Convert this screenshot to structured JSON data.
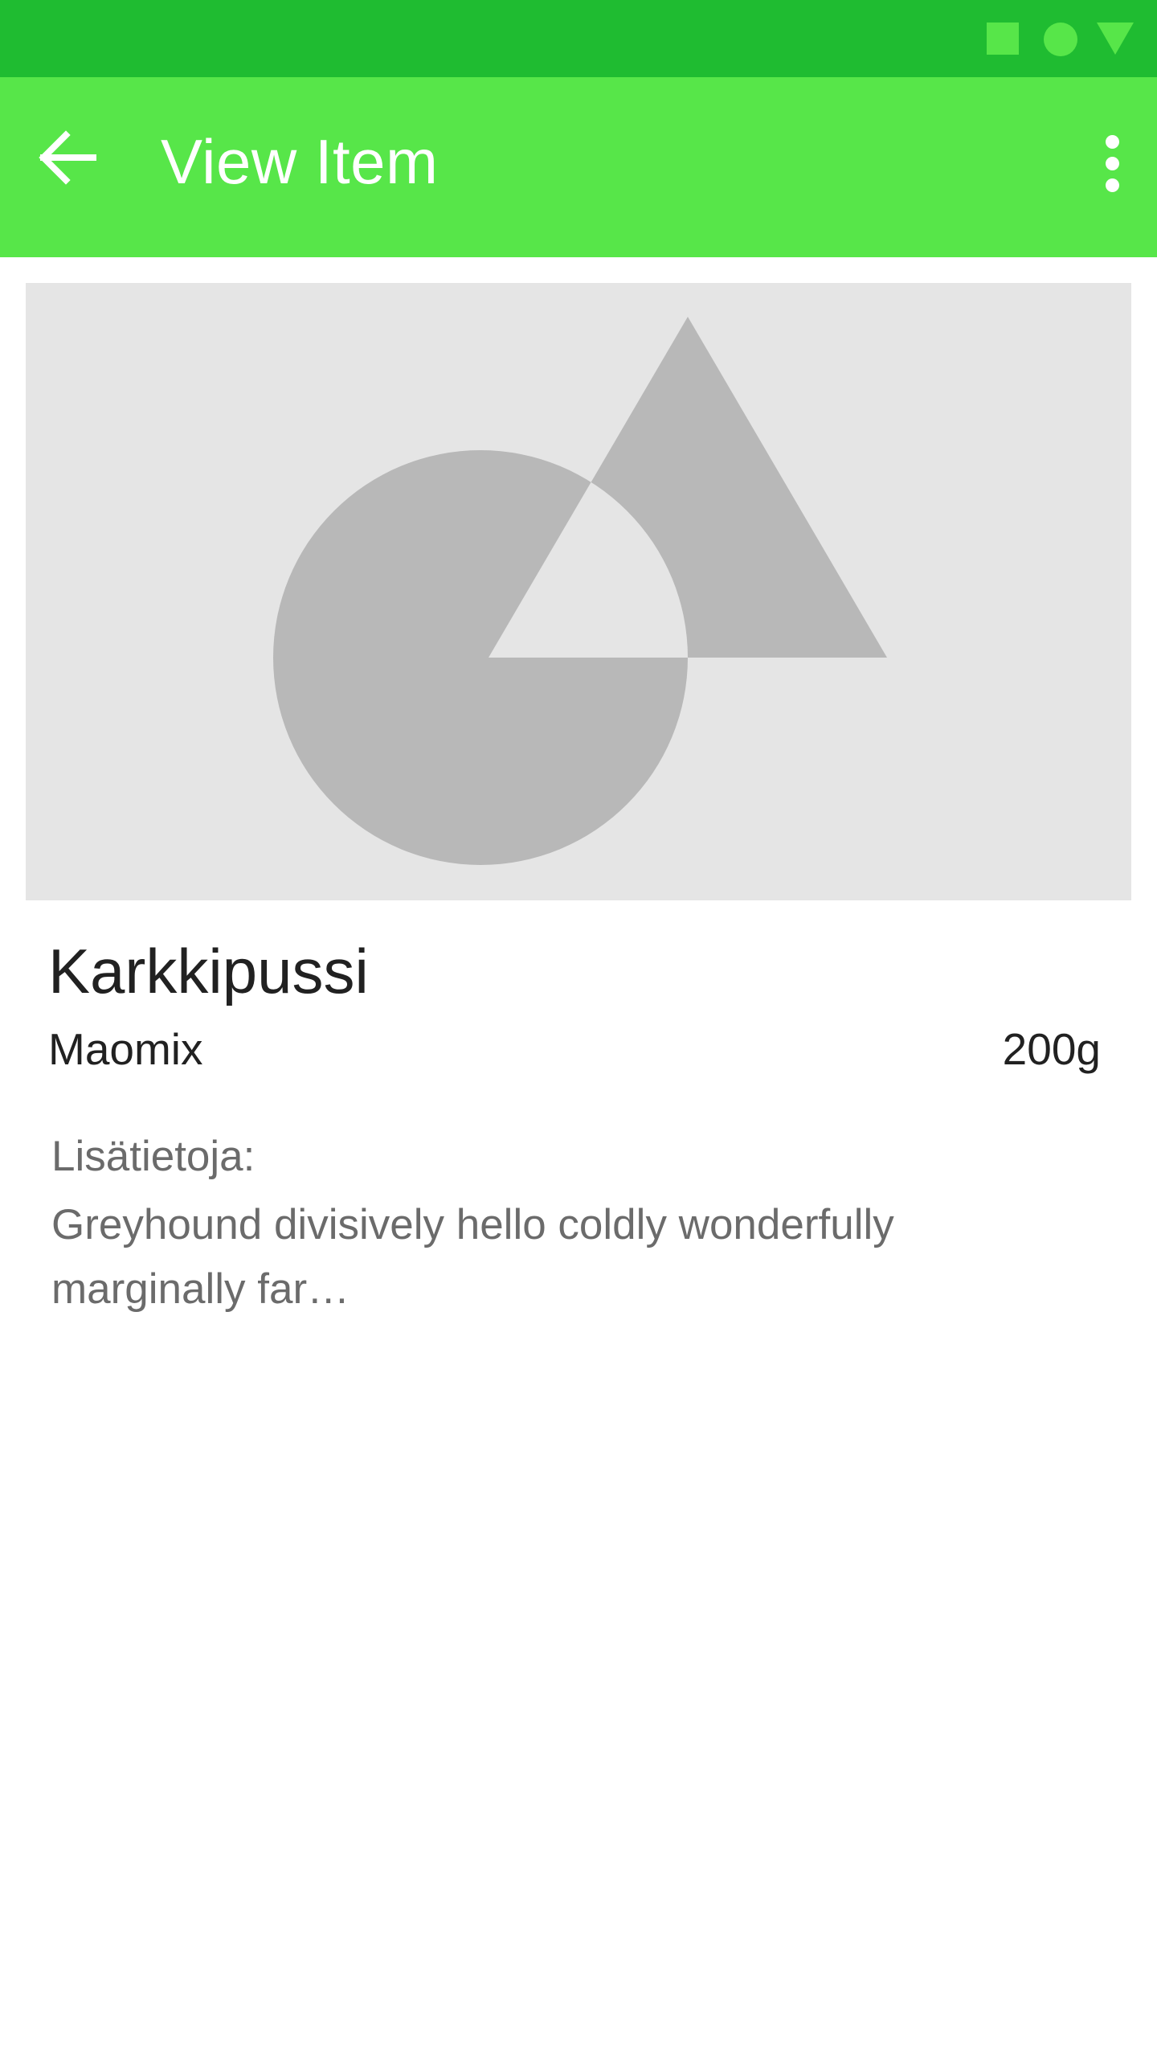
{
  "status_bar": {
    "icons": [
      "square-icon",
      "circle-icon",
      "triangle-icon"
    ],
    "colors": {
      "background": "#1fbc31",
      "icon": "#57e649"
    }
  },
  "app_bar": {
    "title": "View Item",
    "back_icon": "arrow-back-icon",
    "menu_icon": "more-vert-icon",
    "colors": {
      "background": "#57e649",
      "text": "#ffffff"
    }
  },
  "item": {
    "image_icon": "image-placeholder-icon",
    "name": "Karkkipussi",
    "brand": "Maomix",
    "weight": "200g",
    "info_label": "Lisätietoja:",
    "info_text": "Greyhound divisively hello coldly wonderfully marginally far…"
  }
}
